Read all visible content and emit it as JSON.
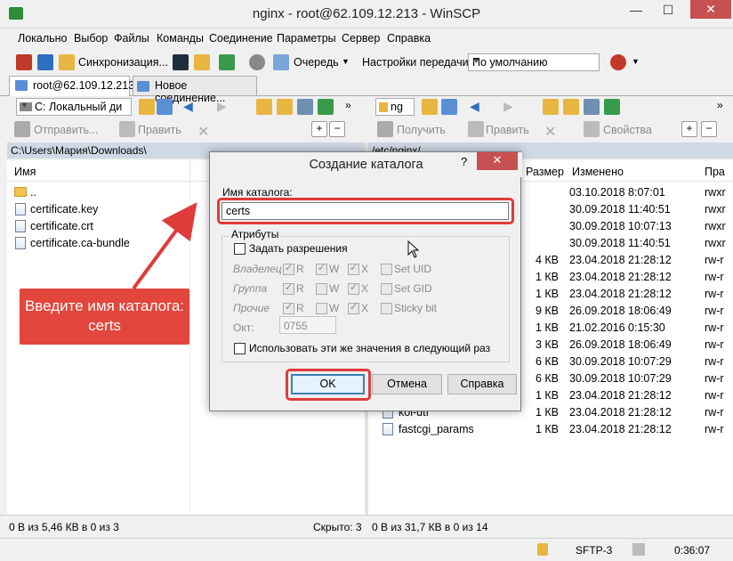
{
  "window": {
    "title": "nginx - root@62.109.12.213 - WinSCP",
    "minimize": "—",
    "maximize": "☐",
    "close": "✕"
  },
  "menu": [
    "Локально",
    "Выбор",
    "Файлы",
    "Команды",
    "Соединение",
    "Параметры",
    "Сервер",
    "Справка"
  ],
  "toolbar": {
    "sync_label": "Синхронизация...",
    "queue_label": "Очередь",
    "transfer_label": "Настройки передачи",
    "transfer_value": "По умолчанию"
  },
  "tabs": [
    {
      "label": "root@62.109.12.213"
    },
    {
      "label": "Новое соединение..."
    }
  ],
  "left_panel": {
    "drive": "C: Локальный ди",
    "send_label": "Отправить...",
    "edit_label": "Править",
    "path": "C:\\Users\\Мария\\Downloads\\",
    "col_name": "Имя",
    "files": [
      "..",
      "certificate.key",
      "certificate.crt",
      "certificate.ca-bundle"
    ],
    "status": "0 В из 5,46 КВ в 0 из 3",
    "hidden": "Скрыто: 3"
  },
  "right_panel": {
    "drive": "ng",
    "get_label": "Получить",
    "edit_label": "Править",
    "props_label": "Свойства",
    "path": "/etc/nginx/",
    "col_size": "Размер",
    "col_changed": "Изменено",
    "col_rights": "Пра",
    "rows": [
      {
        "size": "",
        "changed": "03.10.2018 8:07:01",
        "rights": "rwxr"
      },
      {
        "size": "",
        "changed": "30.09.2018 11:40:51",
        "rights": "rwxr"
      },
      {
        "size": "",
        "changed": "30.09.2018 10:07:13",
        "rights": "rwxr"
      },
      {
        "size": "",
        "changed": "30.09.2018 11:40:51",
        "rights": "rwxr"
      },
      {
        "size": "4 КВ",
        "changed": "23.04.2018 21:28:12",
        "rights": "rw-r"
      },
      {
        "size": "1 КВ",
        "changed": "23.04.2018 21:28:12",
        "rights": "rw-r"
      },
      {
        "size": "1 КВ",
        "changed": "23.04.2018 21:28:12",
        "rights": "rw-r"
      },
      {
        "size": "9 КВ",
        "changed": "26.09.2018 18:06:49",
        "rights": "rw-r"
      },
      {
        "size": "1 КВ",
        "changed": "21.02.2016 0:15:30",
        "rights": "rw-r"
      },
      {
        "size": "3 КВ",
        "changed": "26.09.2018 18:06:49",
        "rights": "rw-r"
      },
      {
        "size": "6 КВ",
        "changed": "30.09.2018 10:07:29",
        "rights": "rw-r"
      },
      {
        "size": "6 КВ",
        "changed": "30.09.2018 10:07:29",
        "rights": "rw-r"
      },
      {
        "size": "1 КВ",
        "changed": "23.04.2018 21:28:12",
        "rights": "rw-r"
      },
      {
        "size": "1 КВ",
        "changed": "23.04.2018 21:28:12",
        "rights": "rw-r"
      },
      {
        "size": "1 КВ",
        "changed": "23.04.2018 21:28:12",
        "rights": "rw-r"
      }
    ],
    "visible_names": {
      "koi_utf": "koi-utf",
      "fastcgi": "fastcgi_params"
    },
    "status": "0 В из 31,7 КВ в 0 из 14"
  },
  "statusbar": {
    "protocol": "SFTP-3",
    "time": "0:36:07"
  },
  "dialog": {
    "title": "Создание каталога",
    "help_mark": "?",
    "close": "✕",
    "name_label": "Имя каталога:",
    "name_value": "certs",
    "attributes_label": "Атрибуты",
    "set_permissions": "Задать разрешения",
    "owner": "Владелец",
    "group": "Группа",
    "others": "Прочие",
    "r": "R",
    "w": "W",
    "x": "X",
    "setuid": "Set UID",
    "setgid": "Set GID",
    "sticky": "Sticky bit",
    "octal_label": "Окт:",
    "octal_value": "0755",
    "reuse": "Использовать эти же значения в следующий раз",
    "ok": "OK",
    "cancel": "Отмена",
    "help": "Справка"
  },
  "callout": "Введите имя каталога: certs",
  "colors": {
    "annotation_red": "#e03b3b",
    "pathbar": "#cfd8e5"
  }
}
